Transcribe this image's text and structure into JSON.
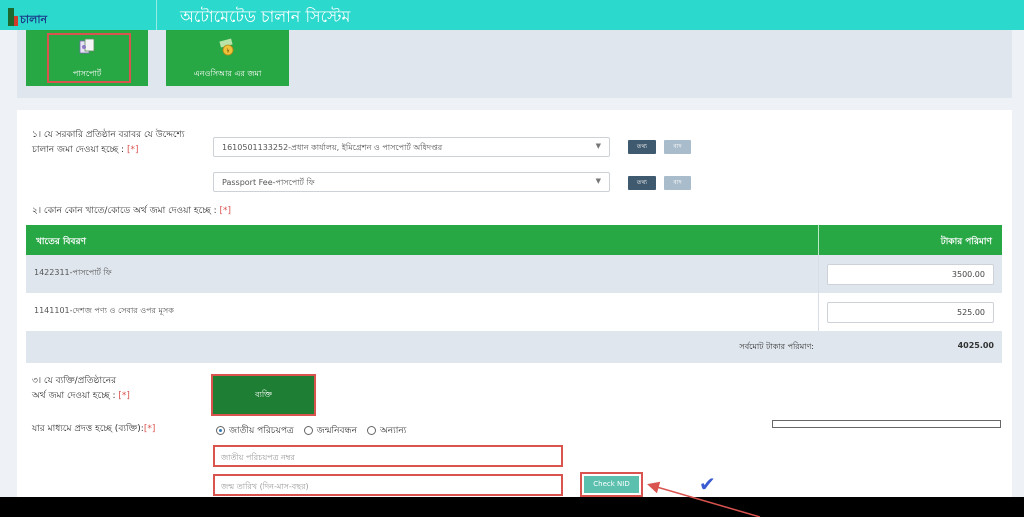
{
  "header": {
    "logo_text": "চালান",
    "title": "অটোমেটেড চালান সিস্টেম"
  },
  "tiles": [
    {
      "label": "পাসপোর্ট",
      "icon": "passport-icon"
    },
    {
      "label": "এনওসিআর এর জমা",
      "icon": "money-icon"
    }
  ],
  "form": {
    "q1_label_line1": "১। যে সরকারি প্রতিষ্ঠান বরাবর যে উদ্দেশ্যে",
    "q1_label_line2": "চালান জমা দেওয়া হচ্ছে : ",
    "required_mark": "[*]",
    "office_select": "1610501133252-প্রধান কার্যালয়, ইমিগ্রেশন ও পাসপোর্ট অধিদপ্তর",
    "fee_select": "Passport Fee-পাসপোর্ট ফি",
    "btn_dark_1": "তথ্য",
    "btn_light_1": "বাদ",
    "btn_dark_2": "তথ্য",
    "btn_light_2": "বাদ",
    "q2_label": "২। কোন কোন খাতে/কোডে অর্থ জমা দেওয়া হচ্ছে : ",
    "table": {
      "col_desc": "খাতের বিবরণ",
      "col_amount": "টাকার পরিমাণ",
      "rows": [
        {
          "name": "1422311-পাসপোর্ট ফি",
          "amount": "3500.00"
        },
        {
          "name": "1141101-দেশজ পণ্য ও সেবার ওপর মূসক",
          "amount": "525.00"
        }
      ],
      "total_label": "সর্বমোট টাকার পরিমাণ:",
      "total_value": "4025.00"
    },
    "q3_label_line1": "৩। যে ব্যক্তি/প্রতিষ্ঠানের",
    "q3_label_line2": "অর্থ জমা দেওয়া হচ্ছে : ",
    "person_button": "ব্যক্তি",
    "via_label": "যার মাধ্যমে প্রদত্ত হচ্ছে (ব্যক্তি):",
    "radio_options": [
      "জাতীয় পরিচয়পত্র",
      "জন্মনিবন্ধন",
      "অন্যান্য"
    ],
    "radio_selected": 0,
    "nid_placeholder": "জাতীয় পরিচয়পত্র নম্বর",
    "dob_placeholder": "জন্ম তারিখ (দিন-মাস-বছর)",
    "check_nid": "Check NID"
  },
  "colors": {
    "header": "#2bd9cd",
    "green": "#28a745",
    "highlight": "#d9534f"
  }
}
